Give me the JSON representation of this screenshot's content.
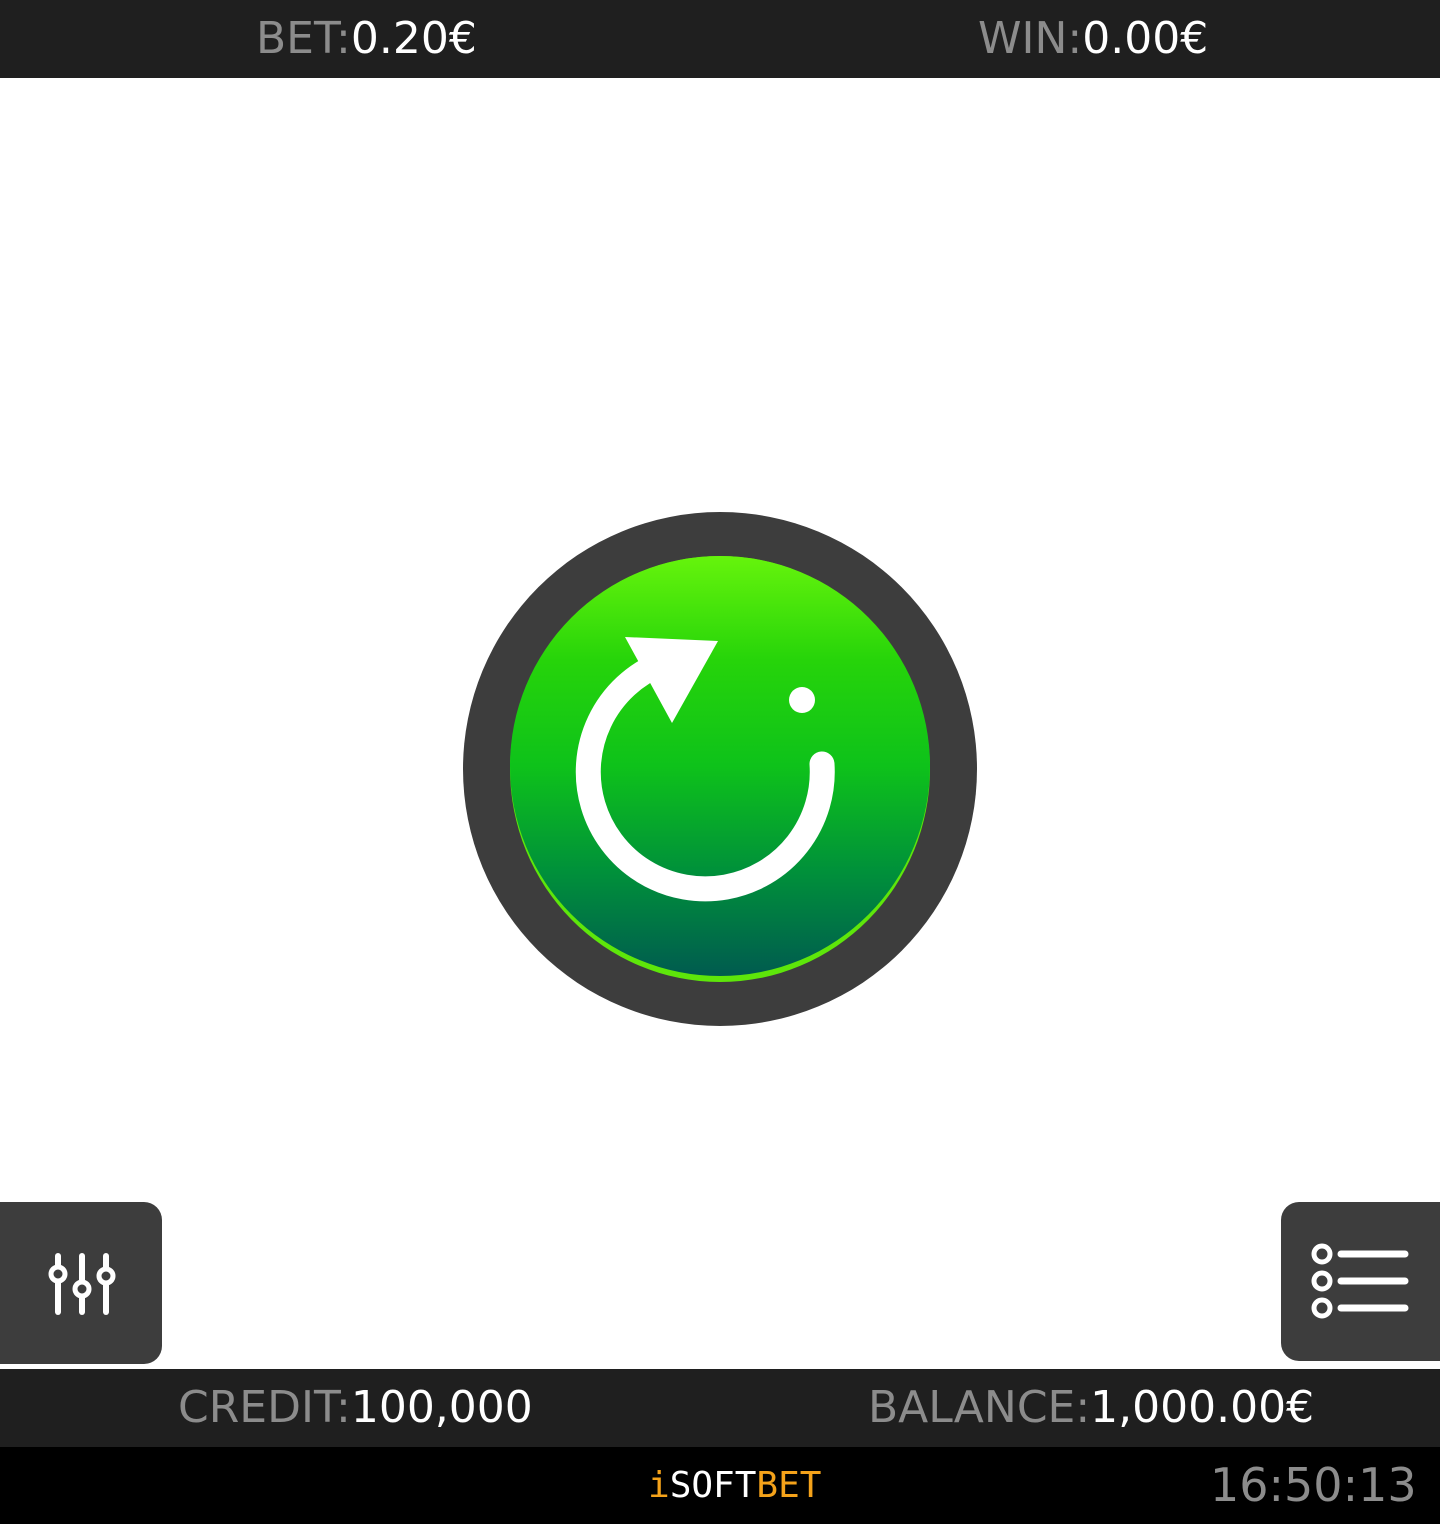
{
  "top_bar": {
    "bet_label": "BET:",
    "bet_value": "0.20€",
    "win_label": "WIN:",
    "win_value": "0.00€"
  },
  "info_bar": {
    "credit_label": "CREDIT:",
    "credit_value": "100,000",
    "balance_label": "BALANCE:",
    "balance_value": "1,000.00€"
  },
  "footer": {
    "brand_i": "i",
    "brand_soft": "SOFT",
    "brand_bet": "BET",
    "clock": "16:50:13"
  },
  "icons": {
    "spin": "refresh-arrow-icon",
    "settings": "sliders-icon",
    "menu": "list-menu-icon"
  },
  "colors": {
    "bar_background": "#1f1f1f",
    "button_background": "#3d3d3d",
    "spin_green_top": "#66f40c",
    "spin_green_bottom": "#005b4f",
    "label_gray": "#8c8c8c",
    "brand_orange": "#f4a21a"
  }
}
